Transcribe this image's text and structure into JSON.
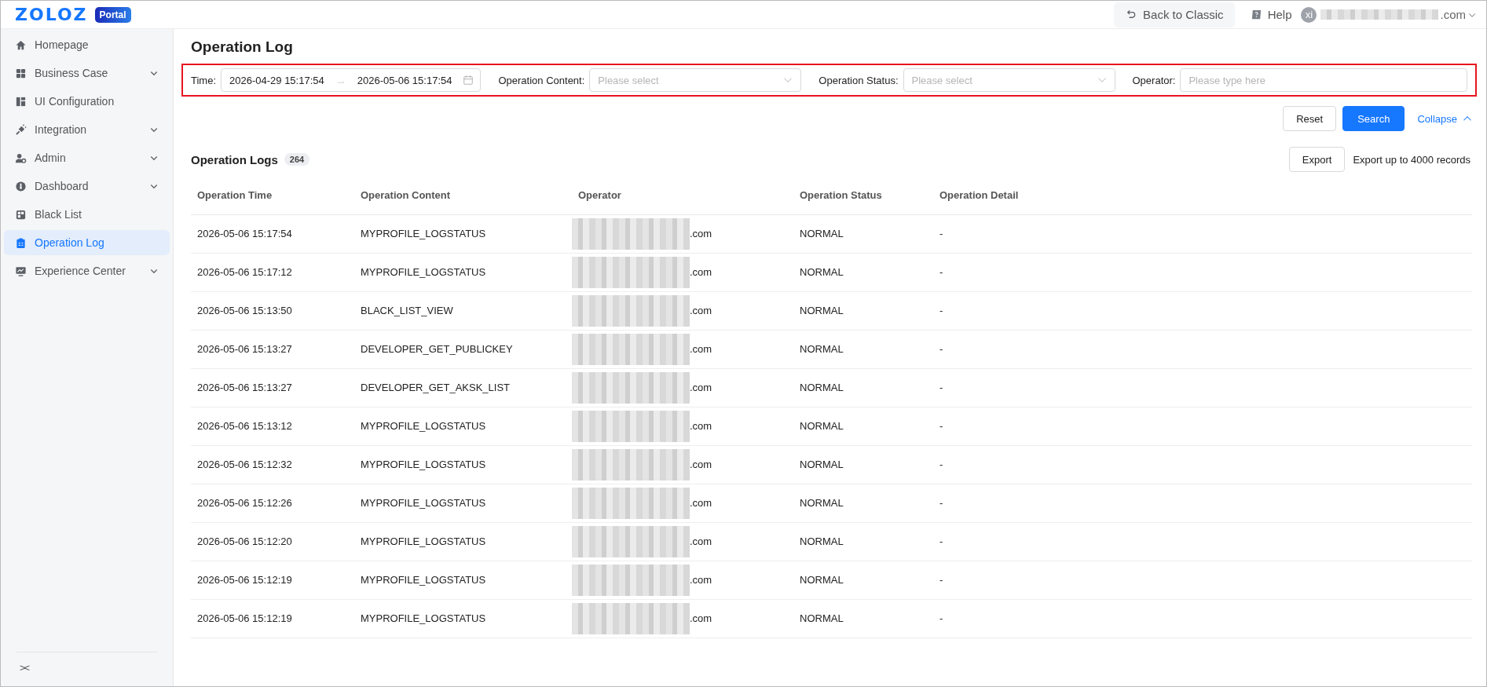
{
  "header": {
    "logo": "ZOLOZ",
    "logo_badge": "Portal",
    "back_button": "Back to Classic",
    "help": "Help",
    "avatar": "xi",
    "account_suffix": ".com"
  },
  "sidebar": {
    "items": [
      {
        "label": "Homepage",
        "expandable": false,
        "selected": false
      },
      {
        "label": "Business Case",
        "expandable": true,
        "selected": false
      },
      {
        "label": "UI Configuration",
        "expandable": false,
        "selected": false
      },
      {
        "label": "Integration",
        "expandable": true,
        "selected": false
      },
      {
        "label": "Admin",
        "expandable": true,
        "selected": false
      },
      {
        "label": "Dashboard",
        "expandable": true,
        "selected": false
      },
      {
        "label": "Black List",
        "expandable": false,
        "selected": false
      },
      {
        "label": "Operation Log",
        "expandable": false,
        "selected": true
      },
      {
        "label": "Experience Center",
        "expandable": true,
        "selected": false
      }
    ],
    "collapse_toggle": "><"
  },
  "page_title": "Operation Log",
  "filters": {
    "time_label": "Time:",
    "time_start": "2026-04-29 15:17:54",
    "time_end": "2026-05-06 15:17:54",
    "content_label": "Operation Content:",
    "content_placeholder": "Please select",
    "status_label": "Operation Status:",
    "status_placeholder": "Please select",
    "operator_label": "Operator:",
    "operator_placeholder": "Please type here",
    "reset": "Reset",
    "search": "Search",
    "collapse": "Collapse"
  },
  "logs": {
    "title": "Operation Logs",
    "count": "264",
    "export": "Export",
    "export_note": "Export up to 4000 records",
    "columns": [
      "Operation Time",
      "Operation Content",
      "Operator",
      "Operation Status",
      "Operation Detail"
    ],
    "rows": [
      [
        "2026-05-06 15:17:54",
        "MYPROFILE_LOGSTATUS",
        ".com",
        "NORMAL",
        "-"
      ],
      [
        "2026-05-06 15:17:12",
        "MYPROFILE_LOGSTATUS",
        ".com",
        "NORMAL",
        "-"
      ],
      [
        "2026-05-06 15:13:50",
        "BLACK_LIST_VIEW",
        ".com",
        "NORMAL",
        "-"
      ],
      [
        "2026-05-06 15:13:27",
        "DEVELOPER_GET_PUBLICKEY",
        ".com",
        "NORMAL",
        "-"
      ],
      [
        "2026-05-06 15:13:27",
        "DEVELOPER_GET_AKSK_LIST",
        ".com",
        "NORMAL",
        "-"
      ],
      [
        "2026-05-06 15:13:12",
        "MYPROFILE_LOGSTATUS",
        ".com",
        "NORMAL",
        "-"
      ],
      [
        "2026-05-06 15:12:32",
        "MYPROFILE_LOGSTATUS",
        ".com",
        "NORMAL",
        "-"
      ],
      [
        "2026-05-06 15:12:26",
        "MYPROFILE_LOGSTATUS",
        ".com",
        "NORMAL",
        "-"
      ],
      [
        "2026-05-06 15:12:20",
        "MYPROFILE_LOGSTATUS",
        ".com",
        "NORMAL",
        "-"
      ],
      [
        "2026-05-06 15:12:19",
        "MYPROFILE_LOGSTATUS",
        ".com",
        "NORMAL",
        "-"
      ],
      [
        "2026-05-06 15:12:19",
        "MYPROFILE_LOGSTATUS",
        ".com",
        "NORMAL",
        "-"
      ]
    ]
  }
}
